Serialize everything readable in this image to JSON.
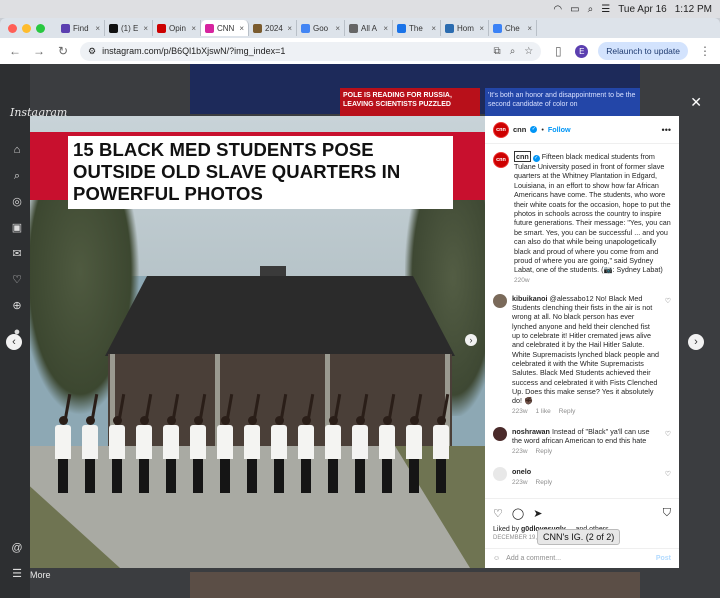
{
  "menubar": {
    "date": "Tue Apr 16",
    "time": "1:12 PM"
  },
  "tabs": [
    {
      "label": "Find",
      "color": "#5b3fb0"
    },
    {
      "label": "(1) E",
      "color": "#111111"
    },
    {
      "label": "Opin",
      "color": "#cc0000"
    },
    {
      "label": "CNN",
      "color": "#d6249f",
      "active": true
    },
    {
      "label": "2024",
      "color": "#7a5b2e"
    },
    {
      "label": "Goo",
      "color": "#4285f4"
    },
    {
      "label": "All A",
      "color": "#666666"
    },
    {
      "label": "The",
      "color": "#1a73e8"
    },
    {
      "label": "Hom",
      "color": "#2b6cb0"
    },
    {
      "label": "Che",
      "color": "#3b82f6"
    }
  ],
  "address": {
    "url": "instagram.com/p/B6Ql1bXjswN/?img_index=1"
  },
  "toolbar": {
    "relaunch_label": "Relaunch to update",
    "profile_initial": "E"
  },
  "background": {
    "banner_red": "POLE IS READING FOR RUSSIA, LEAVING SCIENTISTS PUZZLED",
    "banner_blue": "'It's both an honor and disappointment to be the second candidate of color on"
  },
  "sidebar": {
    "logo": "Instagram",
    "more_label": "More"
  },
  "post": {
    "headline": "15 BLACK MED STUDENTS POSE OUTSIDE OLD SLAVE QUARTERS IN POWERFUL PHOTOS",
    "account": "cnn",
    "follow_label": "Follow",
    "caption_user": "cnn",
    "caption_text": "Fifteen black medical students from Tulane University posed in front of former slave quarters at the Whitney Plantation in Edgard, Louisiana, in an effort to show how far African Americans have come. The students, who wore their white coats for the occasion, hope to put the photos in schools across the country to inspire future generations. Their message: \"Yes, you can be smart. Yes, you can be successful ... and you can also do that while being unapologetically black and proud of where you come from and proud of where you are going,\" said Sydney Labat, one of the students. (📷: Sydney Labat)",
    "caption_age": "220w",
    "comments": [
      {
        "user": "kibuikanoi",
        "text": "@alessabo12 No! Black Med Students clenching their fists in the air is not wrong at all. No black person has ever lynched anyone and held their clenched fist up to celebrate it! Hitler cremated jews alive and celebrated it by the Hail Hitler Salute. White Supremacists lynched black people and celebrated it with the White Supremacists Salutes. Black Med Students achieved their success and celebrated it with Fists Clenched Up. Does this make sense? Yes it absolutely do! ✊🏿",
        "age": "223w",
        "likes": "1 like",
        "reply": "Reply",
        "avatar_color": "#7a6a5a"
      },
      {
        "user": "noshrawan",
        "text": "Instead of \"Black\" ya'll can use the word african American to end this hate",
        "age": "223w",
        "reply": "Reply",
        "avatar_color": "#4a2a2a"
      },
      {
        "user": "onelo",
        "text": "",
        "age": "223w",
        "reply": "Reply",
        "avatar_color": "#e8e8e8"
      }
    ],
    "tooltip": "CNN's IG. (2 of 2)",
    "liked_by_prefix": "Liked by",
    "liked_by_user": "g0dlovesugly__",
    "liked_by_suffix": "and others",
    "date": "December 19, 2019",
    "add_comment_placeholder": "Add a comment...",
    "post_label": "Post"
  }
}
